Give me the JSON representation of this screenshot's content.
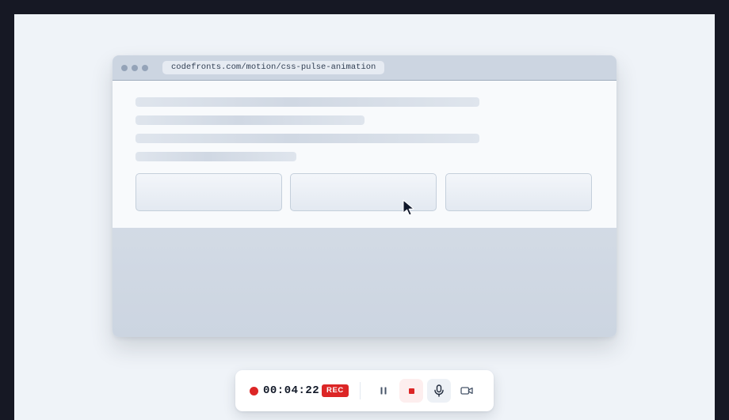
{
  "browser": {
    "url": "codefronts.com/motion/css-pulse-animation"
  },
  "recorder": {
    "timer": "00:04:22",
    "rec_badge": "REC",
    "accent_color": "#dc2626",
    "buttons": [
      {
        "name": "pause",
        "icon": "pause-icon"
      },
      {
        "name": "stop",
        "icon": "stop-icon"
      },
      {
        "name": "microphone",
        "icon": "microphone-icon",
        "state": "active"
      },
      {
        "name": "camera",
        "icon": "video-camera-icon"
      }
    ]
  }
}
